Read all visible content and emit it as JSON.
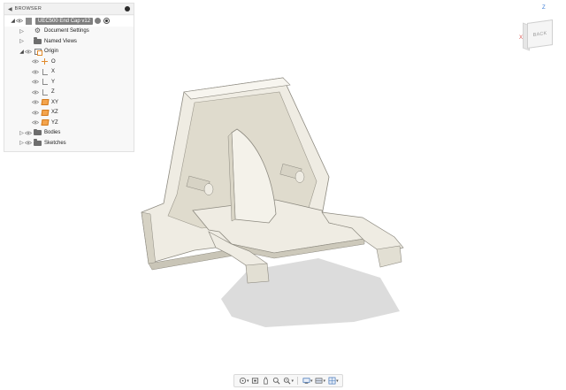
{
  "browser": {
    "title": "BROWSER",
    "document": {
      "name": "UEC500 End Cap v12"
    },
    "items": [
      {
        "label": "Document Settings",
        "icon": "gear-icon",
        "indent": 1
      },
      {
        "label": "Named Views",
        "icon": "folder-icon",
        "indent": 1
      },
      {
        "label": "Origin",
        "icon": "origin-icon",
        "indent": 1
      },
      {
        "label": "O",
        "icon": "origin-point-icon",
        "indent": 2
      },
      {
        "label": "X",
        "icon": "axis-icon",
        "indent": 2
      },
      {
        "label": "Y",
        "icon": "axis-icon",
        "indent": 2
      },
      {
        "label": "Z",
        "icon": "axis-icon",
        "indent": 2
      },
      {
        "label": "XY",
        "icon": "plane-icon",
        "indent": 2
      },
      {
        "label": "XZ",
        "icon": "plane-icon",
        "indent": 2
      },
      {
        "label": "YZ",
        "icon": "plane-icon",
        "indent": 2
      },
      {
        "label": "Bodies",
        "icon": "folder-icon",
        "indent": 1
      },
      {
        "label": "Sketches",
        "icon": "folder-icon",
        "indent": 1
      }
    ]
  },
  "viewcube": {
    "face_label": "BACK",
    "z_label": "Z",
    "x_label": "X"
  },
  "toolbar": {
    "buttons": [
      "orbit-icon",
      "look-at-icon",
      "pan-icon",
      "zoom-icon",
      "fit-icon",
      "display-settings-icon",
      "visual-style-icon",
      "grid-icon"
    ]
  },
  "colors": {
    "part_face": "#efece3",
    "part_shade": "#d9d5c6",
    "part_edge": "#8d8a80",
    "orange_accent": "#e08a2c"
  }
}
